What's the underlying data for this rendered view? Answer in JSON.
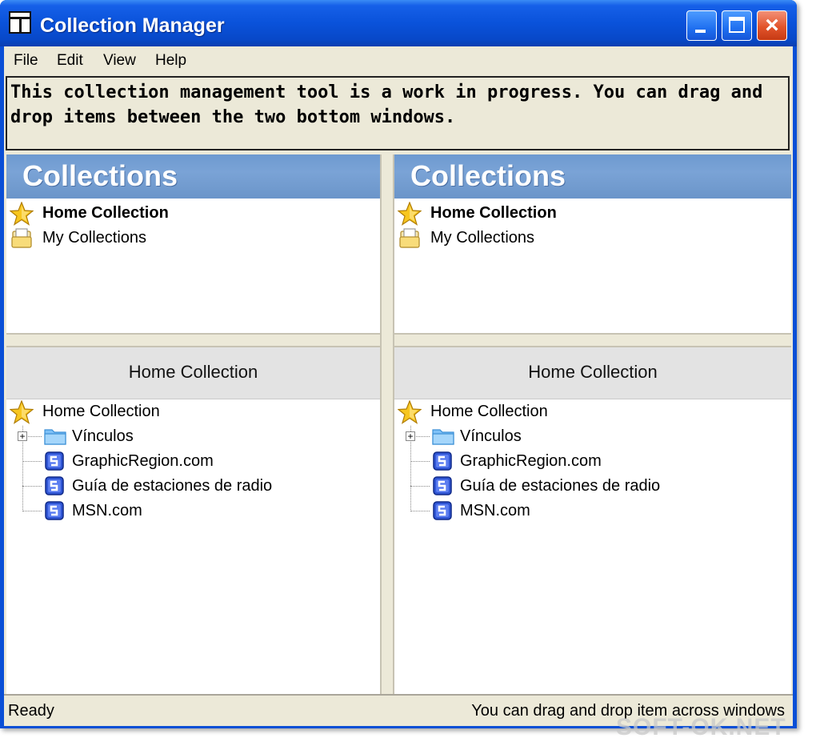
{
  "window": {
    "title": "Collection Manager",
    "controls": {
      "minimize": "minimize",
      "maximize": "maximize",
      "close": "×"
    }
  },
  "menu": [
    "File",
    "Edit",
    "View",
    "Help"
  ],
  "info_text": "This collection management tool is a work in progress.  You can drag and drop items between the two bottom windows.",
  "panes": [
    {
      "header": "Collections",
      "list": [
        {
          "label": "Home Collection",
          "icon": "star-icon",
          "bold": true
        },
        {
          "label": "My Collections",
          "icon": "folder-open-icon",
          "bold": false
        }
      ],
      "sub_header": "Home Collection",
      "tree": {
        "root": "Home Collection",
        "children": [
          {
            "label": "Vínculos",
            "icon": "folder-icon",
            "expander": "+"
          },
          {
            "label": "GraphicRegion.com",
            "icon": "link-icon"
          },
          {
            "label": "Guía de estaciones de radio",
            "icon": "link-icon"
          },
          {
            "label": "MSN.com",
            "icon": "link-icon"
          }
        ]
      }
    },
    {
      "header": "Collections",
      "list": [
        {
          "label": "Home Collection",
          "icon": "star-icon",
          "bold": true
        },
        {
          "label": "My Collections",
          "icon": "folder-open-icon",
          "bold": false
        }
      ],
      "sub_header": "Home Collection",
      "tree": {
        "root": "Home Collection",
        "children": [
          {
            "label": "Vínculos",
            "icon": "folder-icon",
            "expander": "+"
          },
          {
            "label": "GraphicRegion.com",
            "icon": "link-icon"
          },
          {
            "label": "Guía de estaciones de radio",
            "icon": "link-icon"
          },
          {
            "label": "MSN.com",
            "icon": "link-icon"
          }
        ]
      }
    }
  ],
  "status": {
    "left": "Ready",
    "right": "You can drag and drop item across windows"
  },
  "watermark": "SOFT-OK.NET",
  "colors": {
    "titlebar": "#0a52da",
    "pane_header": "#7aa3d6",
    "chrome": "#ece9d8"
  }
}
